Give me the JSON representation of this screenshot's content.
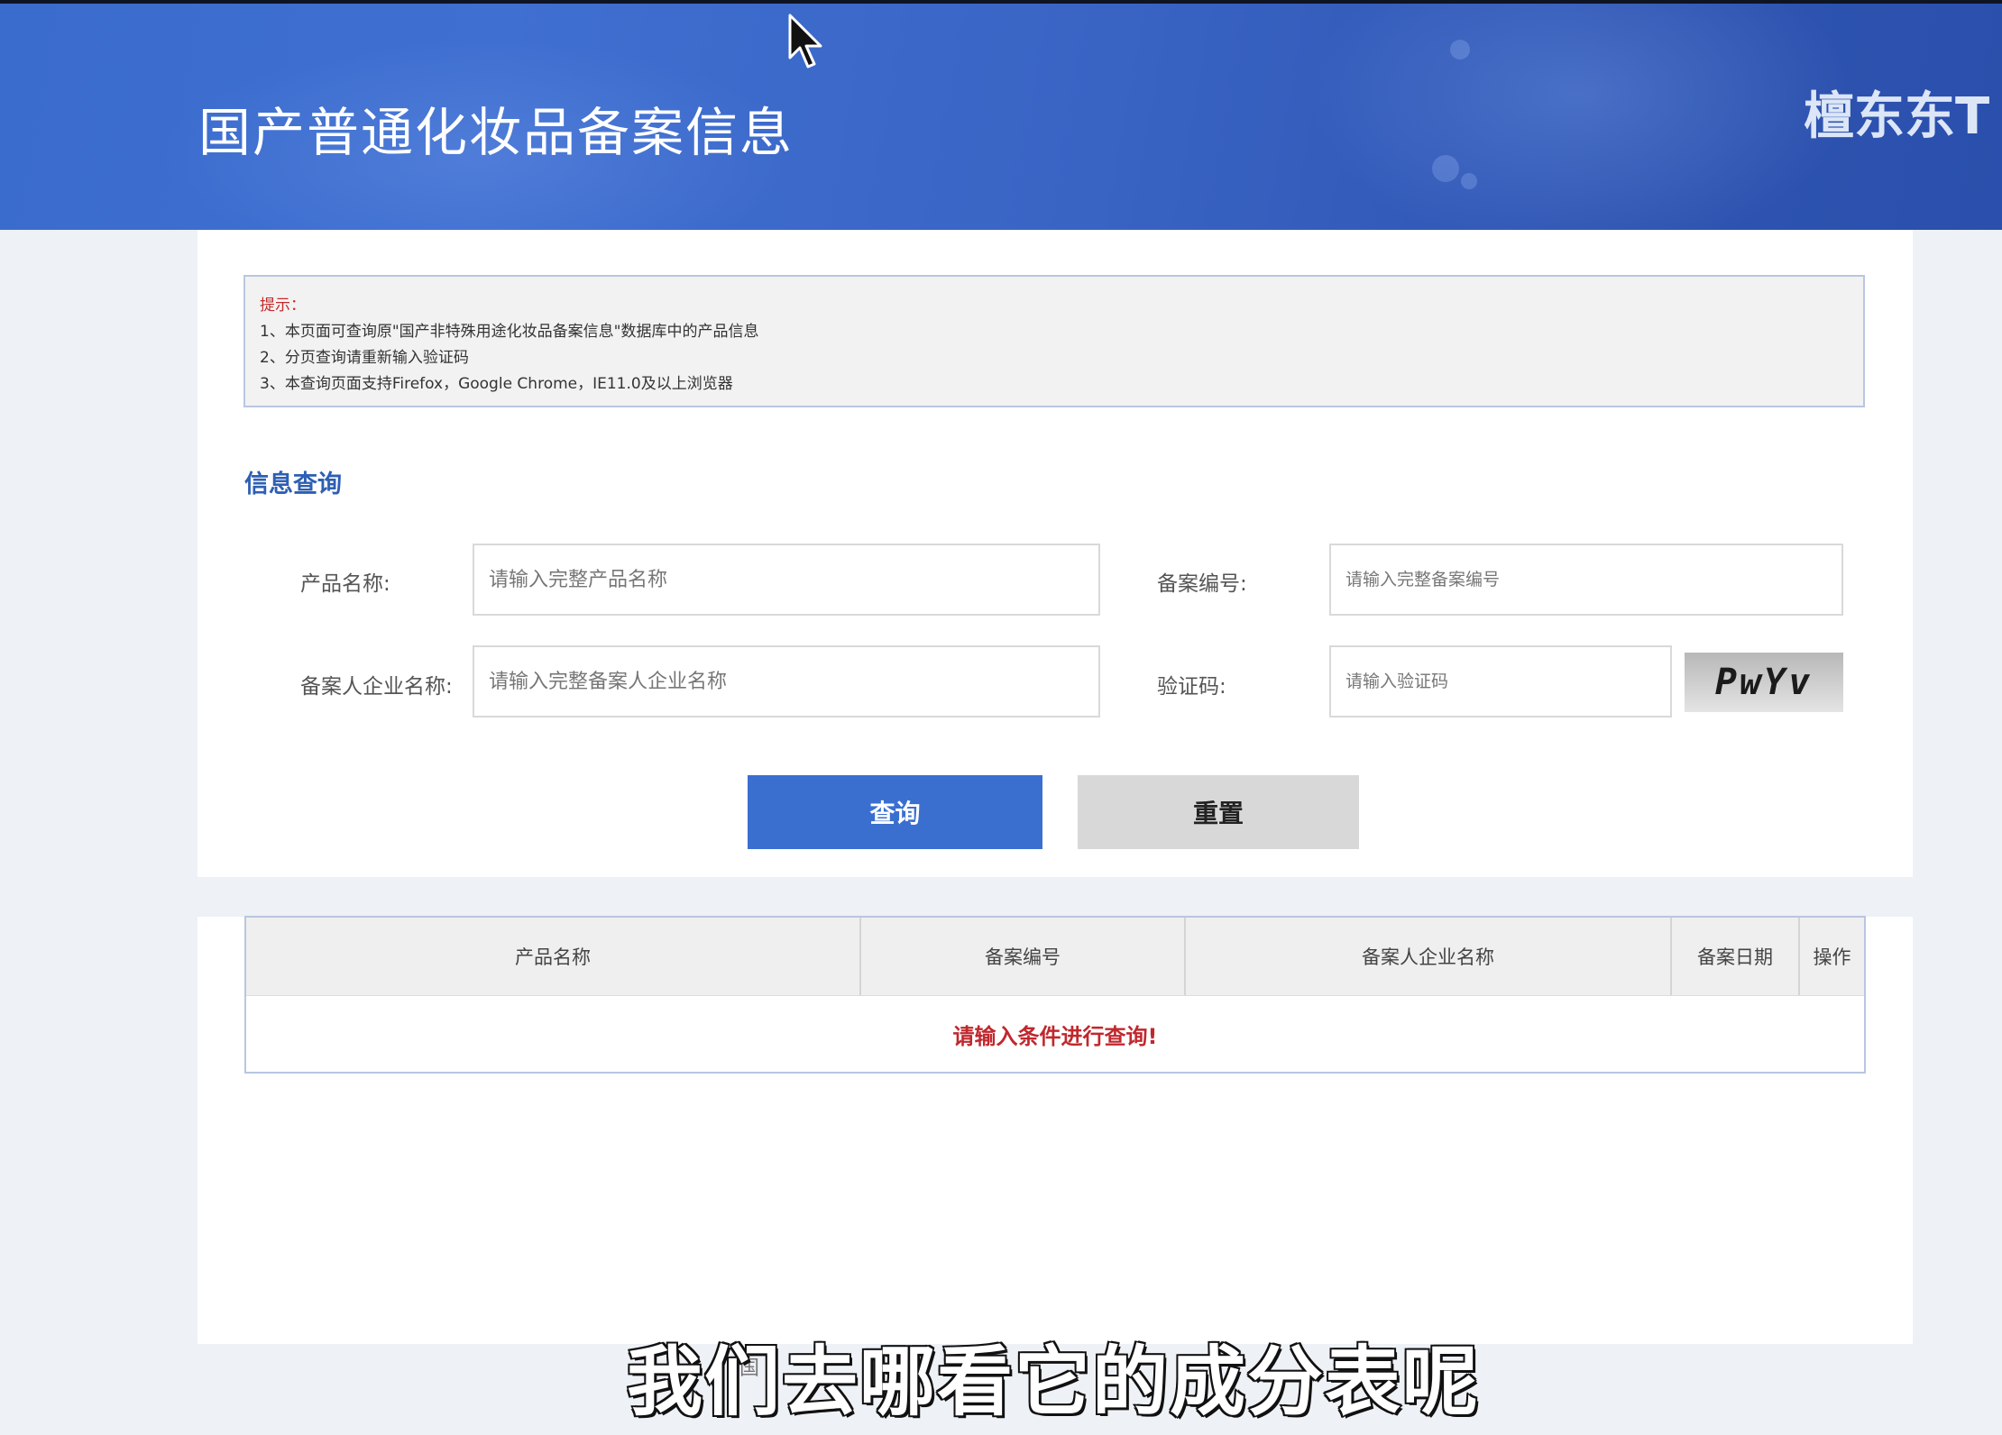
{
  "header": {
    "title": "国产普通化妆品备案信息",
    "user_text": "檀东东T"
  },
  "notice": {
    "label": "提示：",
    "lines": [
      "1、本页面可查询原\"国产非特殊用途化妆品备案信息\"数据库中的产品信息",
      "2、分页查询请重新输入验证码",
      "3、本查询页面支持Firefox，Google Chrome，IE11.0及以上浏览器"
    ]
  },
  "search": {
    "section_title": "信息查询",
    "product_name_label": "产品名称:",
    "product_name_placeholder": "请输入完整产品名称",
    "record_no_label": "备案编号:",
    "record_no_placeholder": "请输入完整备案编号",
    "company_label": "备案人企业名称:",
    "company_placeholder": "请输入完整备案人企业名称",
    "captcha_label": "验证码:",
    "captcha_placeholder": "请输入验证码",
    "captcha_text": "PwYv",
    "query_button": "查询",
    "reset_button": "重置"
  },
  "results": {
    "columns": [
      "产品名称",
      "备案编号",
      "备案人企业名称",
      "备案日期",
      "操作"
    ],
    "empty_message": "请输入条件进行查询!"
  },
  "footer": {
    "partial_text": "国"
  },
  "video_subtitle": "我们去哪看它的成分表呢",
  "colors": {
    "header_blue": "#3a6ccd",
    "accent": "#3a6fd0",
    "section_title": "#2d5fb4",
    "warning_red": "#c0282d"
  }
}
